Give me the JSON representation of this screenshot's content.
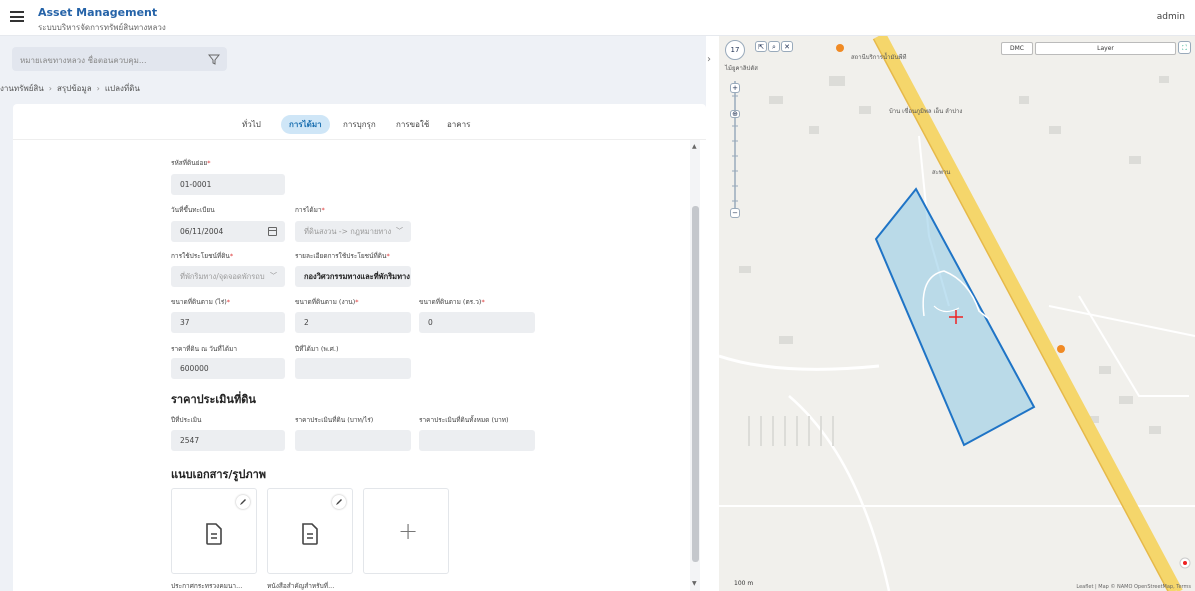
{
  "app": {
    "title": "Asset Management",
    "subtitle": "ระบบบริหารจัดการทรัพย์สินทางหลวง",
    "user": "admin"
  },
  "search": {
    "placeholder": "หมายเลขทางหลวง ชื่อตอนควบคุม..."
  },
  "breadcrumb": [
    "งานทรัพย์สิน",
    "สรุปข้อมูล",
    "แปลงที่ดิน"
  ],
  "tabs": [
    {
      "label": "ทั่วไป",
      "active": false
    },
    {
      "label": "การได้มา",
      "active": true
    },
    {
      "label": "การบุกรุก",
      "active": false
    },
    {
      "label": "การขอใช้",
      "active": false
    },
    {
      "label": "อาคาร",
      "active": false
    }
  ],
  "form": {
    "parcel_id": {
      "label": "รหัสที่ดินย่อย",
      "value": "01-0001"
    },
    "reg_date": {
      "label": "วันที่ขึ้นทะเบียน",
      "value": "06/11/2004"
    },
    "acquisition": {
      "label": "การได้มา",
      "value": "ที่ดินสงวน -> กฎหมายทาง"
    },
    "land_use": {
      "label": "การใช้ประโยชน์ที่ดิน",
      "value": "ที่พักริมทาง/จุดจอดพักรถบ"
    },
    "land_use_detail": {
      "label": "รายละเอียดการใช้ประโยชน์ที่ดิน",
      "value": "กองวิศวกรรมทางและที่พักริมทาง"
    },
    "size_rai": {
      "label": "ขนาดที่ดินตาม (ไร่)",
      "value": "37"
    },
    "size_ngan": {
      "label": "ขนาดที่ดินตาม (งาน)",
      "value": "2"
    },
    "size_wa": {
      "label": "ขนาดที่ดินตาม (ตร.ว)",
      "value": "0"
    },
    "price_acq": {
      "label": "ราคาที่ดิน ณ วันที่ได้มา",
      "value": "600000"
    },
    "year_acq": {
      "label": "ปีที่ได้มา (พ.ศ.)",
      "value": ""
    }
  },
  "valuation": {
    "title": "ราคาประเมินที่ดิน",
    "year": {
      "label": "ปีที่ประเมิน",
      "value": "2547"
    },
    "price_per_rai": {
      "label": "ราคาประเมินที่ดิน (บาท/ไร่)",
      "value": ""
    },
    "price_total": {
      "label": "ราคาประเมินที่ดินทั้งหมด (บาท)",
      "value": ""
    }
  },
  "attachments": {
    "title": "แนบเอกสาร/รูปภาพ",
    "files": [
      {
        "caption": "ประกาศกระทรวงคมนา..."
      },
      {
        "caption": "หนังสือสำคัญสำหรับที่..."
      }
    ],
    "add_symbol": "+"
  },
  "map": {
    "zoom": "17",
    "dmc_label": "DMC",
    "layer_label": "Layer",
    "place_labels": [
      "สถานีบริการน้ำมันพีที",
      "ไม้ยูคาลิปตัส",
      "บ้าน เขื่อนภูมิพล เอ็น ลำปาง",
      "สะพาน"
    ],
    "scale": "100 m",
    "attribution": "Leaflet | Map © NAMO OpenStreetMap, Terms",
    "polygon_color": "#1f74c6",
    "road_color": "#f5d66b"
  }
}
